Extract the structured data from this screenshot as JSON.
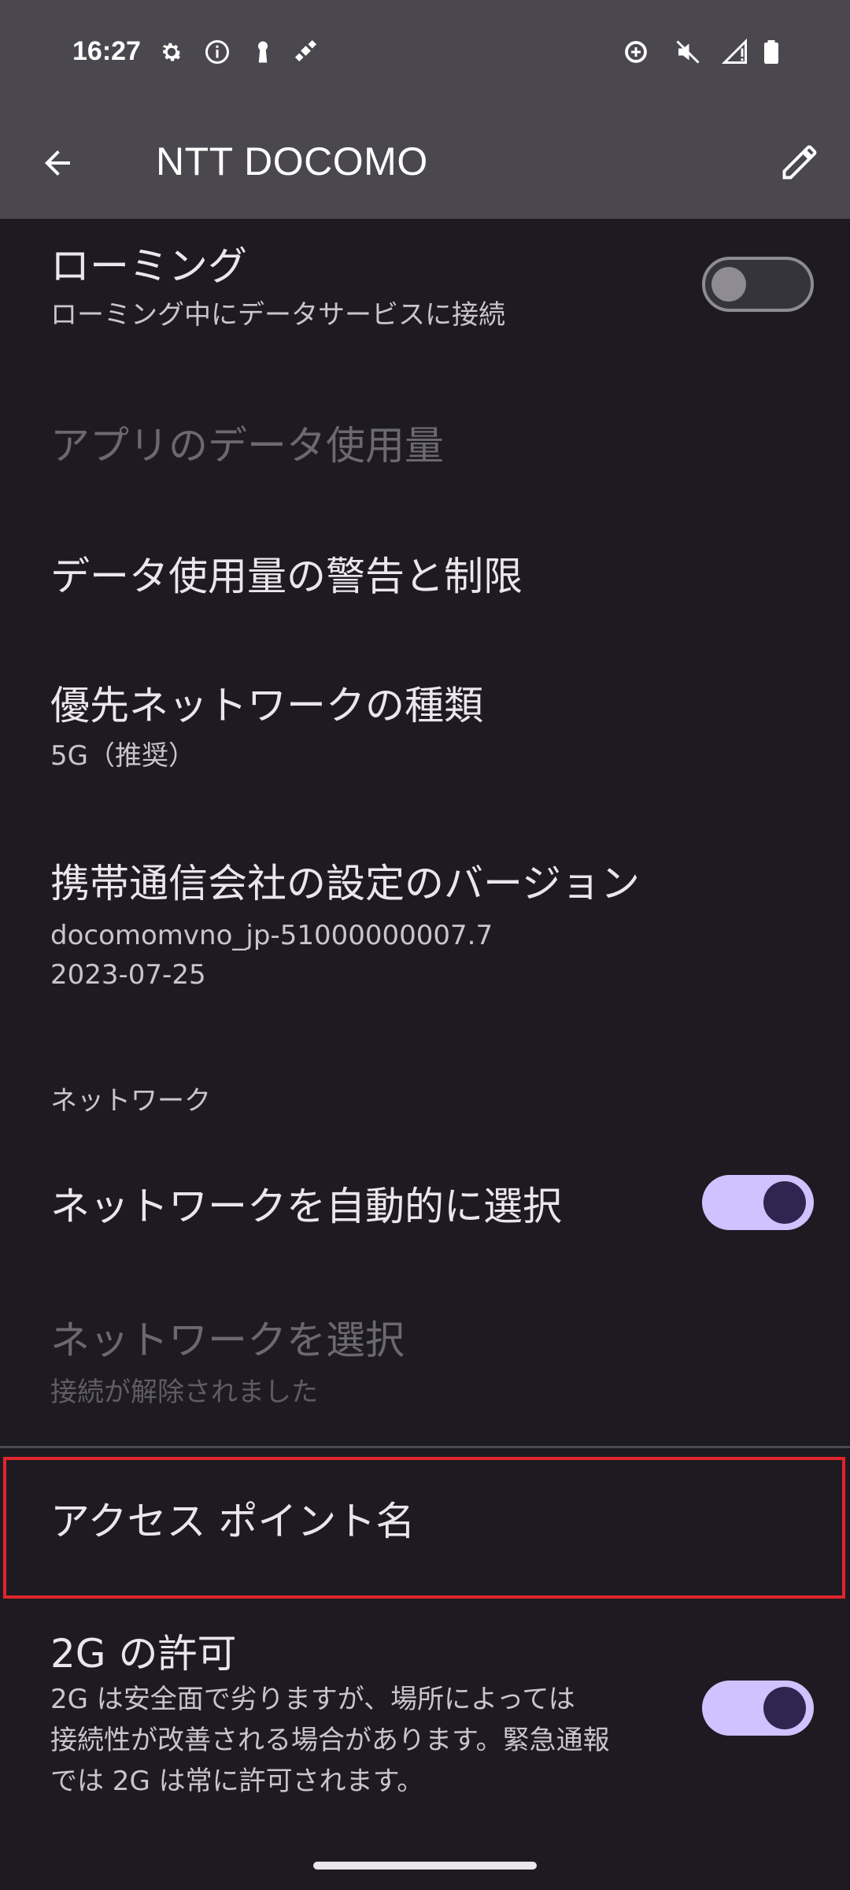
{
  "status_bar": {
    "time": "16:27",
    "left_icons": [
      "gear-icon",
      "info-icon",
      "keyhole-icon",
      "satellite-icon"
    ],
    "right_icons": [
      "data-saver-icon",
      "mute-icon",
      "signal-icon",
      "battery-icon"
    ]
  },
  "app_bar": {
    "title": "NTT DOCOMO"
  },
  "settings": {
    "roaming": {
      "title": "ローミング",
      "summary": "ローミング中にデータサービスに接続",
      "enabled": false
    },
    "app_data_usage": {
      "title": "アプリのデータ使用量"
    },
    "data_warning": {
      "title": "データ使用量の警告と制限"
    },
    "preferred_network": {
      "title": "優先ネットワークの種類",
      "summary": "5G（推奨）"
    },
    "carrier_version": {
      "title": "携帯通信会社の設定のバージョン",
      "summary_line1": "docomomvno_jp-51000000007.7",
      "summary_line2": "2023-07-25"
    },
    "network_category": "ネットワーク",
    "auto_select": {
      "title": "ネットワークを自動的に選択",
      "enabled": true
    },
    "select_network": {
      "title": "ネットワークを選択",
      "summary": "接続が解除されました"
    },
    "apn": {
      "title": "アクセス ポイント名"
    },
    "allow_2g": {
      "title": "2G の許可",
      "summary_line1": "2G は安全面で劣りますが、場所によっては",
      "summary_line2": "接続性が改善される場合があります。緊急通報",
      "summary_line3": "では 2G は常に許可されます。",
      "enabled": true
    }
  },
  "colors": {
    "background": "#1d1b21",
    "header": "#4a484e",
    "switch_on": "#cfc2ff",
    "highlight": "#e0252b"
  }
}
